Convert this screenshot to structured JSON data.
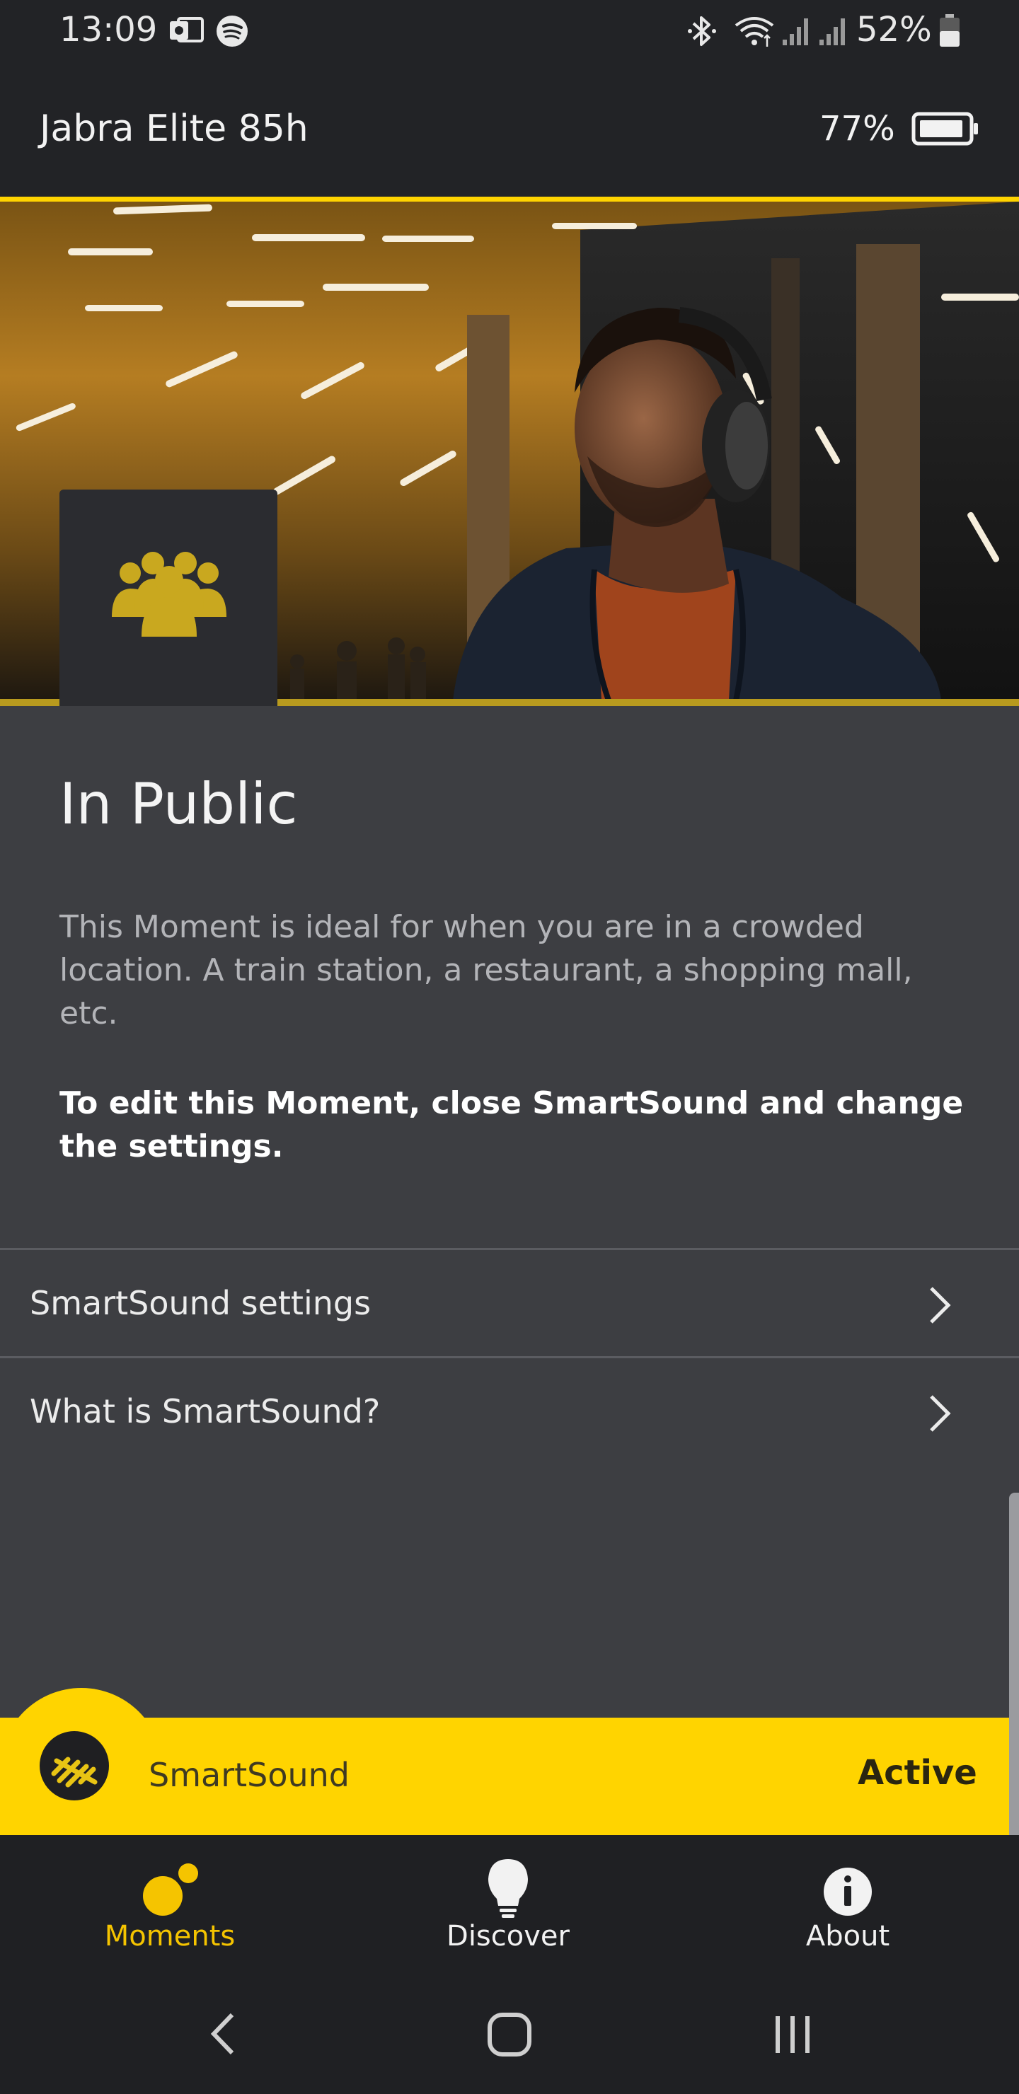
{
  "status_bar": {
    "time": "13:09",
    "battery_percent": "52%",
    "icons": [
      "outlook-icon",
      "spotify-icon",
      "bluetooth-icon",
      "wifi-icon",
      "signal-icon",
      "signal-icon",
      "battery-icon"
    ]
  },
  "header": {
    "device_name": "Jabra Elite 85h",
    "headset_battery": "77%"
  },
  "moment": {
    "title": "In Public",
    "description": "This Moment is ideal for when you are in a crowded location. A train station, a restaurant, a shopping mall, etc.",
    "edit_note": "To edit this Moment, close SmartSound and change the settings.",
    "icon": "group-icon"
  },
  "list": [
    {
      "label": "SmartSound settings"
    },
    {
      "label": "What is SmartSound?"
    }
  ],
  "smartsound": {
    "label": "SmartSound",
    "status": "Active"
  },
  "nav": {
    "moments": "Moments",
    "discover": "Discover",
    "about": "About"
  },
  "colors": {
    "accent": "#ffd400",
    "background": "#3d3e42",
    "header": "#222326",
    "nav_active": "#f5c400"
  }
}
